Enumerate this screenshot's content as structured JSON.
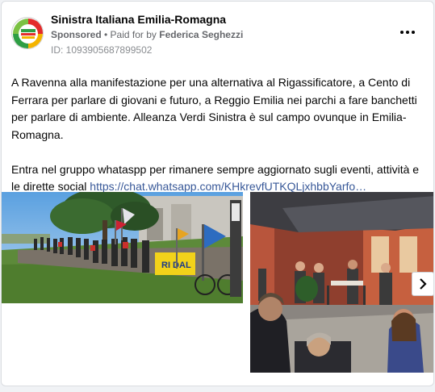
{
  "post": {
    "page_name": "Sinistra Italiana Emilia-Romagna",
    "sponsored_label": "Sponsored",
    "separator": " • ",
    "paid_for_prefix": "Paid for by ",
    "paid_for_name": "Federica Seghezzi",
    "ad_id": "ID: 1093905687899502",
    "paragraph1": "A Ravenna alla manifestazione per una alternativa al Rigassificatore, a Cento di Ferrara per parlare di giovani e futuro, a Reggio Emilia nei parchi a fare banchetti per parlare di ambiente. Alleanza Verdi Sinistra è sul campo ovunque in Emilia-Romagna.",
    "paragraph2": "Entra nel gruppo whataspp per rimanere sempre aggiornato sugli eventi, attività e le dirette social ",
    "link_text": "https://chat.whatsapp.com/KHkrevfUTKQLjxhbbYarfo…"
  },
  "icons": {
    "more": "more-horizontal-icon",
    "next": "chevron-right-icon"
  },
  "colors": {
    "link": "#385898",
    "secondary_text": "#65676b",
    "card_border": "#dadde1",
    "background": "#f0f2f5"
  }
}
